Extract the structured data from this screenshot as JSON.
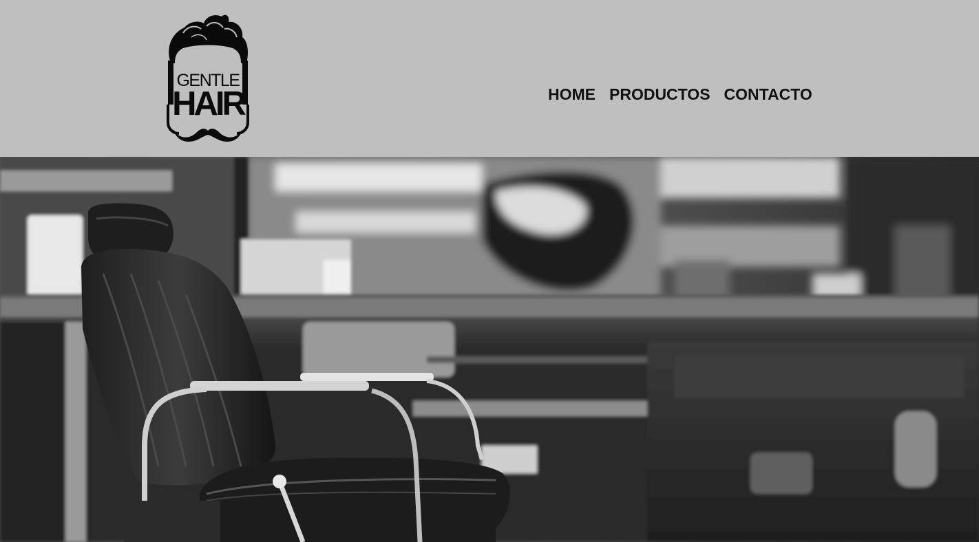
{
  "logo": {
    "line1": "GENTLE",
    "line2": "HAIR"
  },
  "nav": {
    "items": [
      {
        "label": "HOME"
      },
      {
        "label": "PRODUCTOS"
      },
      {
        "label": "CONTACTO"
      }
    ]
  },
  "colors": {
    "header_bg": "#bfbfbf",
    "nav_text": "#111111",
    "logo": "#0a0a0a"
  },
  "hero": {
    "image": "barbershop-chair-photo"
  }
}
